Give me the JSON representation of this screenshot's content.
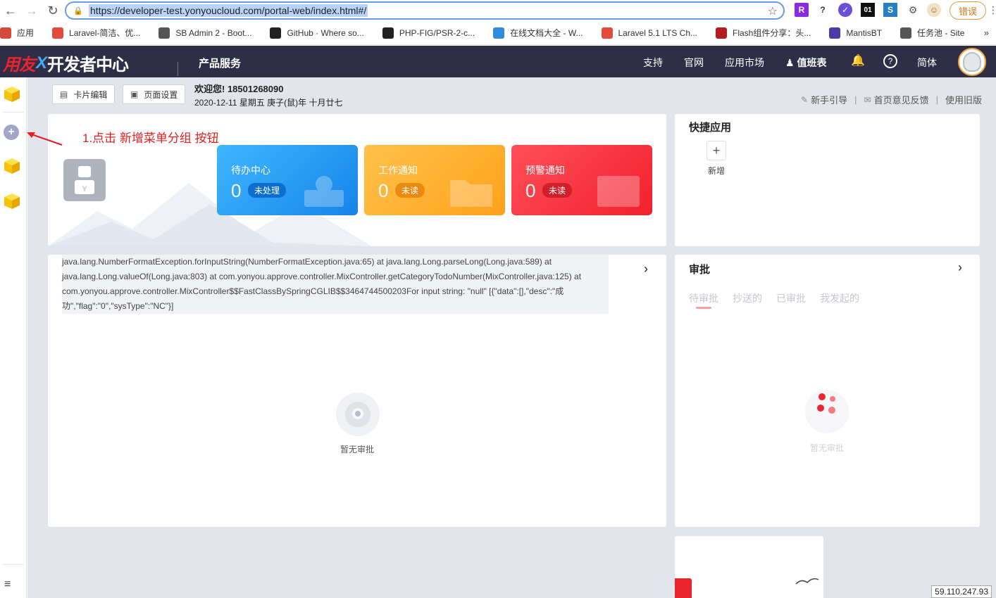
{
  "browser": {
    "url": "https://developer-test.yonyoucloud.com/portal-web/index.html#/",
    "error_label": "错误",
    "help_ext": "?",
    "ext_01": "01",
    "bookmarks": [
      {
        "label": "应用",
        "color": "#d44a3a"
      },
      {
        "label": "Laravel-简洁、优...",
        "color": "#e24a3b"
      },
      {
        "label": "SB Admin 2 - Boot...",
        "color": "#555555"
      },
      {
        "label": "GitHub · Where so...",
        "color": "#222222"
      },
      {
        "label": "PHP-FIG/PSR-2-c...",
        "color": "#222222"
      },
      {
        "label": "在线文档大全 - W...",
        "color": "#2e8be0"
      },
      {
        "label": "Laravel 5.1 LTS Ch...",
        "color": "#e24a3b"
      },
      {
        "label": "Flash组件分享：头...",
        "color": "#b51d1d"
      },
      {
        "label": "MantisBT",
        "color": "#4b3aa8"
      },
      {
        "label": "任务池 - Site",
        "color": "#555555"
      }
    ],
    "more": "»"
  },
  "header": {
    "brand": "用友",
    "title": "开发者中心",
    "product": "产品服务",
    "nav": [
      "支持",
      "官网",
      "应用市场",
      "值班表"
    ],
    "lang": "简体"
  },
  "toolbar": {
    "card_edit": "卡片编辑",
    "page_settings": "页面设置",
    "welcome": "欢迎您!  18501268090",
    "date": "2020-12-11 星期五   庚子(鼠)年 十月廿七",
    "links": [
      "新手引导",
      "首页意见反馈",
      "使用旧版"
    ]
  },
  "stats": [
    {
      "title": "待办中心",
      "count": "0",
      "badge": "未处理"
    },
    {
      "title": "工作通知",
      "count": "0",
      "badge": "未读"
    },
    {
      "title": "预警通知",
      "count": "0",
      "badge": "未读"
    }
  ],
  "quick_apps": {
    "title": "快捷应用",
    "add_label": "新增"
  },
  "todo_card": {
    "error": "java.lang.NumberFormatException.forInputString(NumberFormatException.java:65) at java.lang.Long.parseLong(Long.java:589) at java.lang.Long.valueOf(Long.java:803) at com.yonyou.approve.controller.MixController.getCategoryTodoNumber(MixController.java:125) at com.yonyou.approve.controller.MixController$$FastClassBySpringCGLIB$$3464744500203For input string: \"null\" [{\"data\":[],\"desc\":\"成功\",\"flag\":\"0\",\"sysType\":\"NC\"}]",
    "empty": "暂无审批"
  },
  "approval": {
    "title": "审批",
    "tabs": [
      "待审批",
      "抄送的",
      "已审批",
      "我发起的"
    ],
    "empty": "暂无审批"
  },
  "annotation": "1.点击 新增菜单分组 按钮",
  "ip": "59.110.247.93",
  "colors": {
    "header_bg": "#2f2e47",
    "accent_blue": "#1684e8",
    "accent_orange": "#ffa11c",
    "accent_red": "#f2202e",
    "annotation_red": "#e02020"
  }
}
